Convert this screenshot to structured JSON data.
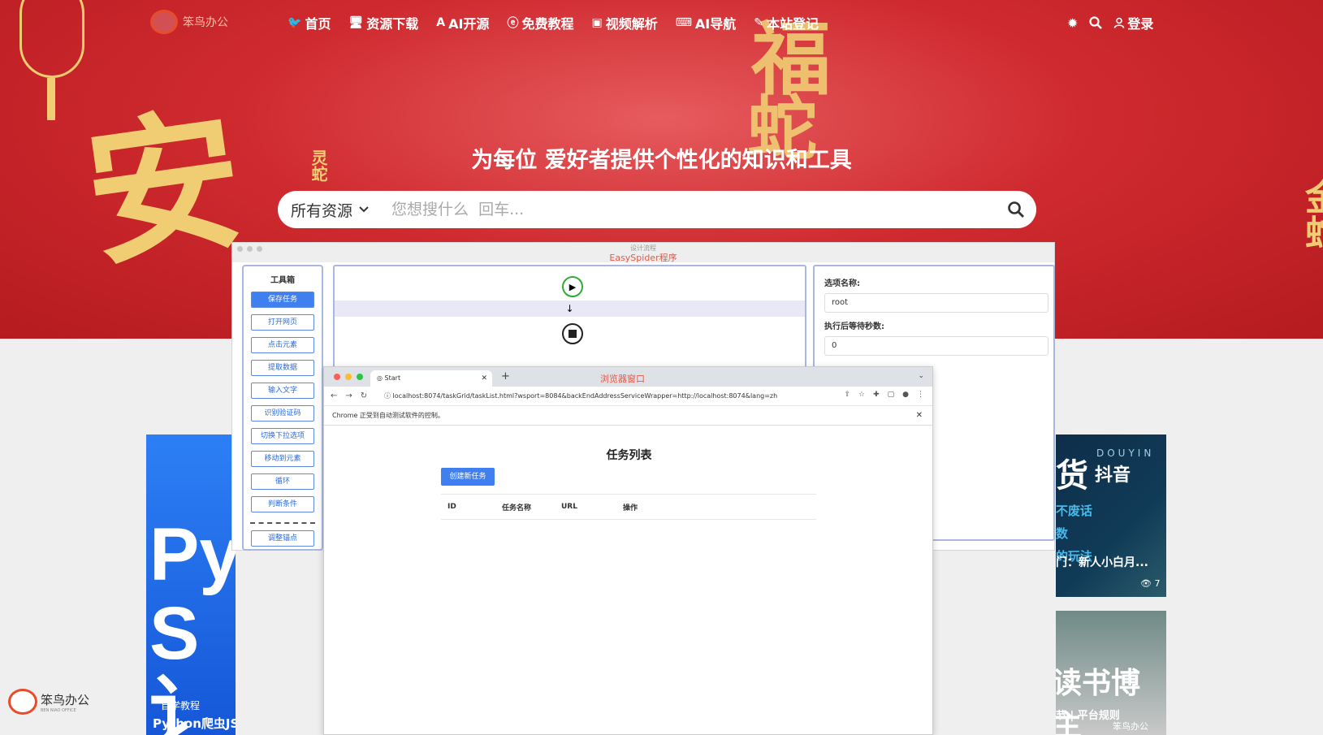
{
  "brand": {
    "name": "笨鸟办公",
    "sub": "BEN NIAO OFFICE"
  },
  "nav": [
    {
      "icon": "bird-icon",
      "glyph": "🐦",
      "label": "首页"
    },
    {
      "icon": "monitor-icon",
      "glyph": "🖥",
      "label": "资源下载"
    },
    {
      "icon": "letter-a-icon",
      "glyph": "A",
      "label": "AI开源"
    },
    {
      "icon": "browser-icon",
      "glyph": "ⓔ",
      "label": "免费教程"
    },
    {
      "icon": "video-icon",
      "glyph": "▣",
      "label": "视频解析"
    },
    {
      "icon": "robot-icon",
      "glyph": "⌨",
      "label": "AI导航"
    },
    {
      "icon": "pen-icon",
      "glyph": "✎",
      "label": "本站登记"
    }
  ],
  "header_right": {
    "login_label": "登录"
  },
  "hero": {
    "title": "为每位 爱好者提供个性化的知识和工具",
    "deco": {
      "an": "安",
      "fu": "福",
      "she": "蛇",
      "lingshe": "灵蛇",
      "right": "金蛇"
    }
  },
  "search": {
    "category": "所有资源",
    "placeholder": "您想搜什么  回车..."
  },
  "easyspider": {
    "subtitle": "设计流程",
    "title": "EasySpider程序",
    "toolbox_title": "工具箱",
    "tools": [
      "保存任务",
      "打开网页",
      "点击元素",
      "提取数据",
      "输入文字",
      "识别验证码",
      "切换下拉选项",
      "移动到元素",
      "循环",
      "判断条件",
      "调整锚点"
    ],
    "props": {
      "name_label": "选项名称:",
      "name_value": "root",
      "wait_label": "执行后等待秒数:",
      "wait_value": "0"
    }
  },
  "browser": {
    "tab_title": "Start",
    "window_label": "浏览器窗口",
    "url": "localhost:8074/taskGrid/taskList.html?wsport=8084&backEndAddressServiceWrapper=http://localhost:8074&lang=zh",
    "info_bar": "Chrome 正受到自动测试软件的控制。",
    "page_title": "任务列表",
    "create_button": "创建新任务",
    "columns": [
      "ID",
      "任务名称",
      "URL",
      "操作"
    ]
  },
  "cards": {
    "left": {
      "big": "Py S讠",
      "tag": "自学教程",
      "title": "Python爬虫JS..."
    },
    "right1": {
      "big": "货",
      "en": "DOUYIN",
      "brand": "抖音",
      "lines": [
        "不废话",
        "数",
        "的玩法"
      ],
      "title": "门：新人小白月...",
      "views": "7"
    },
    "right2": {
      "big": "读书博主",
      "sub": "节 | 平台规则",
      "logo": "笨鸟办公"
    }
  },
  "colors": {
    "hero": "#cf2a2f",
    "accent": "#3f7ff0",
    "gold": "#f0cd73"
  }
}
